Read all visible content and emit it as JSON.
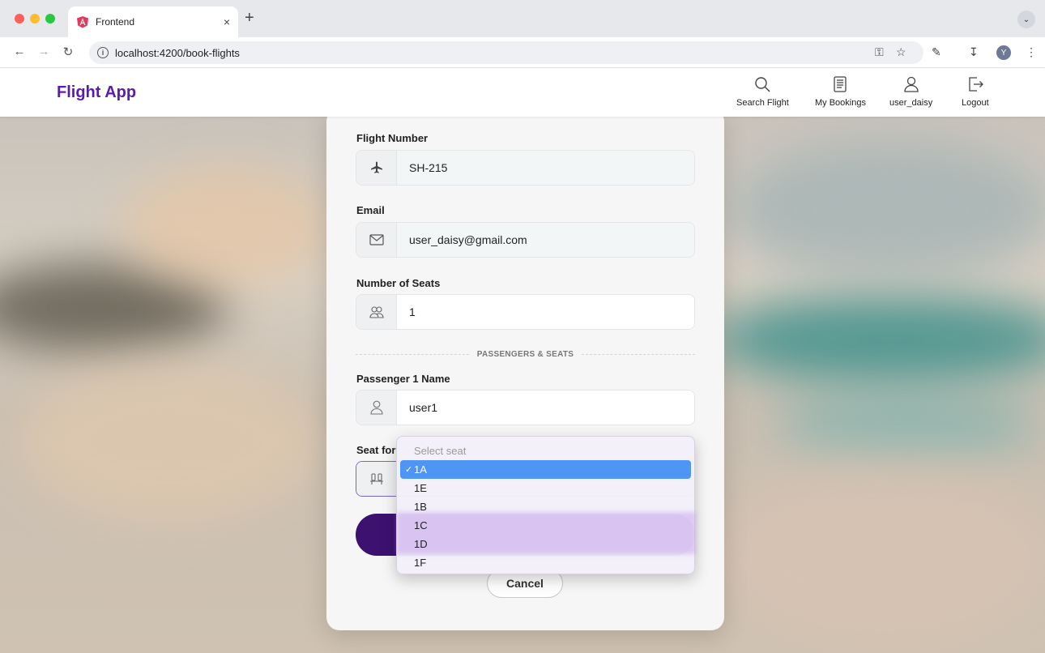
{
  "browser": {
    "tab_title": "Frontend",
    "tab_close": "×",
    "new_tab": "+",
    "url": "localhost:4200/book-flights",
    "profile_initial": "Y"
  },
  "app": {
    "brand": "Flight App",
    "nav": [
      {
        "label": "Search Flight",
        "icon": "search-icon"
      },
      {
        "label": "My Bookings",
        "icon": "document-icon"
      },
      {
        "label": "user_daisy",
        "icon": "user-icon"
      },
      {
        "label": "Logout",
        "icon": "logout-icon"
      }
    ]
  },
  "form": {
    "flight_number_label": "Flight Number",
    "flight_number_value": "SH-215",
    "email_label": "Email",
    "email_value": "user_daisy@gmail.com",
    "seats_label": "Number of Seats",
    "seats_value": "1",
    "divider_text": "PASSENGERS & SEATS",
    "passenger_label": "Passenger 1 Name",
    "passenger_value": "user1",
    "seat_label": "Seat for",
    "cancel_label": "Cancel"
  },
  "seat_dropdown": {
    "placeholder": "Select seat",
    "options": [
      "1A",
      "1E",
      "1B",
      "1C",
      "1D",
      "1F"
    ],
    "selected": "1A"
  },
  "colors": {
    "brand": "#5b1bb0",
    "confirm_button": "#3c1170",
    "dropdown_highlight": "#4f95f3"
  }
}
